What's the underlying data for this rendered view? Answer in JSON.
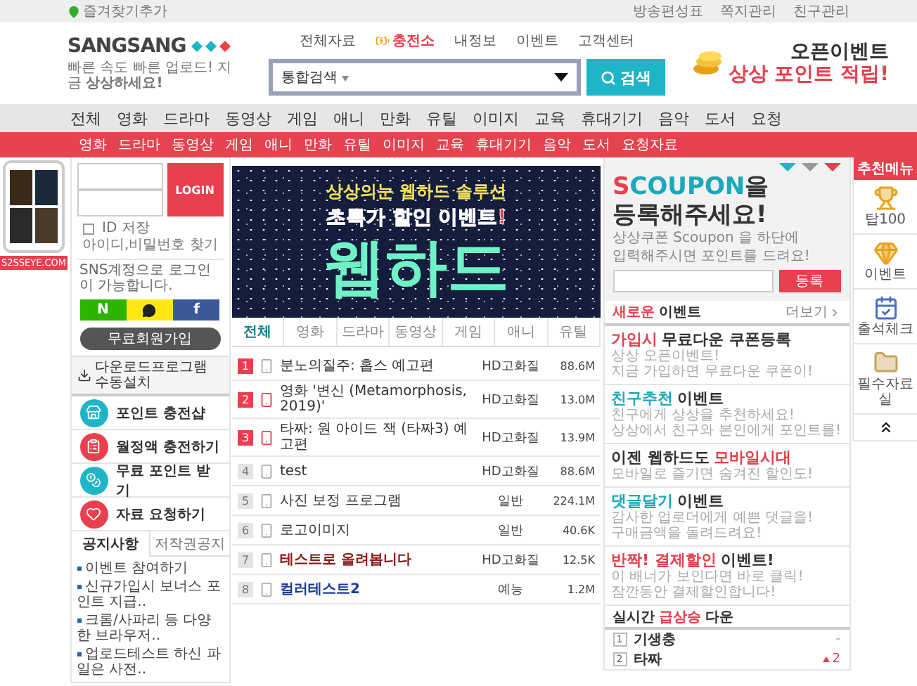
{
  "top_bar": {
    "bookmark": "즐겨찾기추가",
    "links": [
      "방송편성표",
      "쪽지관리",
      "친구관리"
    ]
  },
  "header": {
    "logo": "SANGSANG",
    "tagline": "빠른 속도 빠른 업로드! 지금 **상상하세요!**",
    "top_links": [
      {
        "label": "전체자료",
        "kind": "plain"
      },
      {
        "label": "충전소",
        "kind": "charge"
      },
      {
        "label": "내정보",
        "kind": "plain"
      },
      {
        "label": "이벤트",
        "kind": "plain"
      },
      {
        "label": "고객센터",
        "kind": "plain"
      }
    ],
    "search": {
      "scope": "통합검색",
      "button": "검색"
    },
    "promo": {
      "line_1": "오픈이벤트",
      "line_2": "상상 포인트 적립!"
    }
  },
  "categories": [
    "전체",
    "영화",
    "드라마",
    "동영상",
    "게임",
    "애니",
    "만화",
    "유틸",
    "이미지",
    "교육",
    "휴대기기",
    "음악",
    "도서",
    "요청"
  ],
  "subcategories": [
    "영화",
    "드라마",
    "동영상",
    "게임",
    "애니",
    "만화",
    "유틸",
    "이미지",
    "교육",
    "휴대기기",
    "음악",
    "도서",
    "요청자료"
  ],
  "side_ad": {
    "site": "S2SSEYE.COM"
  },
  "login": {
    "button": "LOGIN",
    "remember": {
      "label": "ID 저장",
      "checked": false
    },
    "find": "아이디,비밀번호 찾기",
    "sns_note": "SNS계정으로 로그인이 가능합니다.",
    "sns": [
      {
        "kind": "naver",
        "label": "N"
      },
      {
        "kind": "kakao"
      },
      {
        "kind": "facebook",
        "label": "f"
      }
    ],
    "join": "무료회원가입"
  },
  "download": "다운로드프로그램 수동설치",
  "quick_menu": [
    {
      "label": "포인트 충전샵",
      "kind": "shop"
    },
    {
      "label": "월정액 충전하기",
      "kind": "monthly"
    },
    {
      "label": "무료 포인트 받기",
      "kind": "free"
    },
    {
      "label": "자료 요청하기",
      "kind": "request"
    }
  ],
  "notice_tabs": [
    {
      "label": "공지사항",
      "selected": true
    },
    {
      "label": "저작권공지",
      "selected": false
    }
  ],
  "notices": [
    "이벤트 참여하기",
    "신규가입시 보너스 포인트 지급..",
    "크롬/사파리 등 다양한 브라우저..",
    "업로드테스트 하신 파일은 사전.."
  ],
  "banner": {
    "line_1": "상상의눈 웹하드 솔루션",
    "line_2": "초특가 할인 이벤트!",
    "line_3": "웹하드"
  },
  "tabs": [
    {
      "label": "전체",
      "selected": true
    },
    {
      "label": "영화",
      "selected": false
    },
    {
      "label": "드라마",
      "selected": false
    },
    {
      "label": "동영상",
      "selected": false
    },
    {
      "label": "게임",
      "selected": false
    },
    {
      "label": "애니",
      "selected": false
    },
    {
      "label": "유틸",
      "selected": false
    }
  ],
  "files": [
    {
      "rank": "1",
      "hot": true,
      "mobile": false,
      "title": "분노의질주: 홉스 예고편",
      "color": "#333333",
      "bold": false,
      "type": "HD고화질",
      "size": "88.6M"
    },
    {
      "rank": "2",
      "hot": true,
      "mobile": true,
      "title": "영화 '변신 (Metamorphosis, 2019)'",
      "color": "#333333",
      "bold": false,
      "type": "HD고화질",
      "size": "13.0M"
    },
    {
      "rank": "3",
      "hot": true,
      "mobile": true,
      "title": "타짜: 원 아이드 잭 (타짜3) 예고편",
      "color": "#333333",
      "bold": false,
      "type": "HD고화질",
      "size": "13.9M"
    },
    {
      "rank": "4",
      "hot": false,
      "mobile": false,
      "title": "test",
      "color": "#333333",
      "bold": false,
      "type": "HD고화질",
      "size": "88.6M"
    },
    {
      "rank": "5",
      "hot": false,
      "mobile": false,
      "title": "사진 보정 프로그램",
      "color": "#333333",
      "bold": false,
      "type": "일반",
      "size": "224.1M"
    },
    {
      "rank": "6",
      "hot": false,
      "mobile": false,
      "title": "로고이미지",
      "color": "#333333",
      "bold": false,
      "type": "일반",
      "size": "40.6K"
    },
    {
      "rank": "7",
      "hot": false,
      "mobile": false,
      "title": "테스트로 올려봅니다",
      "color": "#8b1a1a",
      "bold": true,
      "type": "HD고화질",
      "size": "12.5K"
    },
    {
      "rank": "8",
      "hot": false,
      "mobile": false,
      "title": "컬러테스트2",
      "color": "#1a3c9c",
      "bold": true,
      "type": "예능",
      "size": "1.2M"
    }
  ],
  "coupon": {
    "title": [
      {
        "text": "S",
        "color": "#e8404f"
      },
      {
        "text": "COUPON",
        "color": "#19a9bb"
      },
      {
        "text": "을",
        "color": "#333333"
      }
    ],
    "title_line_2": "등록해주세요!",
    "desc": [
      "상상쿠폰 Scoupon 을 하단에",
      "입력해주시면 포인트를 드려요!"
    ],
    "button": "등록"
  },
  "events_header": {
    "title": [
      {
        "text": "새로운",
        "color": "#e8404f"
      },
      {
        "text": "이벤트",
        "color": "#333333"
      }
    ],
    "more": "더보기"
  },
  "events": [
    {
      "title": [
        {
          "text": "가입시",
          "color": "#e8404f"
        },
        {
          "text": "무료다운 쿠폰등록",
          "color": "#333333"
        }
      ],
      "desc": [
        "상상 오픈이벤트!",
        "지금 가입하면 무료다운 쿠폰이!"
      ]
    },
    {
      "title": [
        {
          "text": "친구추천",
          "color": "#19a9bb"
        },
        {
          "text": "이벤트",
          "color": "#333333"
        }
      ],
      "desc": [
        "친구에게 상상을 추천하세요!",
        "상상에서 친구와 본인에게 포인트를!"
      ]
    },
    {
      "title": [
        {
          "text": "이젠 웹하드도",
          "color": "#333333"
        },
        {
          "text": "모바일시대",
          "color": "#e8404f"
        }
      ],
      "desc": [
        "모바일로 즐기면 숨겨진 할인도!"
      ]
    },
    {
      "title": [
        {
          "text": "댓글달기",
          "color": "#19a9bb"
        },
        {
          "text": "이벤트",
          "color": "#333333"
        }
      ],
      "desc": [
        "감사한 업로더에게 예쁜 댓글을!",
        "구매금액을 돌려드려요!"
      ]
    },
    {
      "title": [
        {
          "text": "반짝! 결제할인",
          "color": "#e8404f"
        },
        {
          "text": "이벤트!",
          "color": "#333333"
        }
      ],
      "desc": [
        "이 배너가 보인다면 바로 클릭!",
        "잠깐동안 결제할인합니다!"
      ]
    }
  ],
  "ranking": {
    "title": [
      {
        "text": "실시간",
        "color": "#333333"
      },
      {
        "text": "급상승",
        "color": "#e8404f"
      },
      {
        "text": "다운",
        "color": "#333333"
      }
    ],
    "rows": [
      {
        "rank": "1",
        "title": "기생충",
        "change": "-",
        "rising": false
      },
      {
        "rank": "2",
        "title": "타짜",
        "change": "2",
        "rising": true
      }
    ]
  },
  "recommend": {
    "title": "추천메뉴",
    "items": [
      {
        "label": "탑100",
        "kind": "top"
      },
      {
        "label": "이벤트",
        "kind": "event"
      },
      {
        "label": "출석체크",
        "kind": "calendar"
      },
      {
        "label": "필수자료실",
        "kind": "folder"
      }
    ]
  }
}
